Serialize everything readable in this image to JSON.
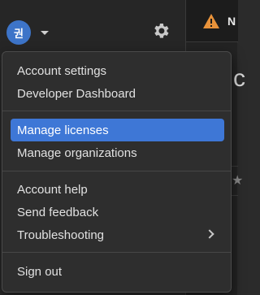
{
  "header": {
    "avatar_initial": "권",
    "avatar_color": "#3d74c8",
    "settings_icon": "gear-icon"
  },
  "background_panel": {
    "warning_icon": "warning-triangle-icon",
    "warning_color": "#e8923a",
    "warning_text_fragment": "N",
    "large_text_fragment": "c"
  },
  "menu": {
    "groups": [
      {
        "items": [
          {
            "label": "Account settings"
          },
          {
            "label": "Developer Dashboard"
          }
        ]
      },
      {
        "items": [
          {
            "label": "Manage licenses",
            "selected": true
          },
          {
            "label": "Manage organizations"
          }
        ]
      },
      {
        "items": [
          {
            "label": "Account help"
          },
          {
            "label": "Send feedback"
          },
          {
            "label": "Troubleshooting",
            "submenu": true,
            "submenu_icon": "chevron-right-icon"
          }
        ]
      },
      {
        "items": [
          {
            "label": "Sign out"
          }
        ]
      }
    ],
    "selected_color": "#3e77d6"
  }
}
